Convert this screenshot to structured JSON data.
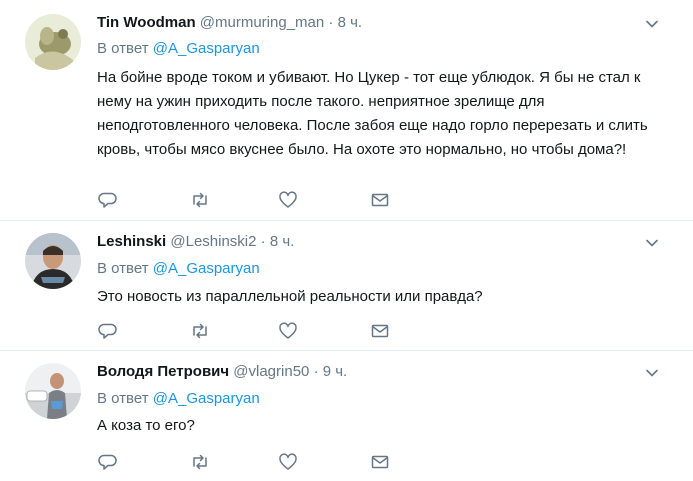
{
  "tweets": [
    {
      "name": "Tin Woodman",
      "handle": "@murmuring_man",
      "separator": "·",
      "time": "8 ч.",
      "reply_prefix": "В ответ",
      "reply_to": "@A_Gasparyan",
      "text": "На бойне вроде током и убивают. Но Цукер - тот еще ублюдок. Я бы не стал к нему на ужин приходить после такого. неприятное зрелище для неподготовленного человека. После забоя еще надо горло перерезать и слить кровь, чтобы мясо вкуснее было. На охоте это нормально, но чтобы дома?!"
    },
    {
      "name": "Leshinski",
      "handle": "@Leshinski2",
      "separator": "·",
      "time": "8 ч.",
      "reply_prefix": "В ответ",
      "reply_to": "@A_Gasparyan",
      "text": "Это новость из параллельной реальности или правда?"
    },
    {
      "name": "Володя Петрович",
      "handle": "@vlagrin50",
      "separator": "·",
      "time": "9 ч.",
      "reply_prefix": "В ответ",
      "reply_to": "@A_Gasparyan",
      "text": "А коза то его?"
    }
  ],
  "icons": {
    "reply": "reply-icon",
    "retweet": "retweet-icon",
    "like": "heart-icon",
    "dm": "envelope-icon",
    "menu": "chevron-down-icon"
  },
  "colors": {
    "link": "#1b95e0",
    "secondary_text": "#657786",
    "icon": "#657786",
    "divider": "#e6ecf0"
  }
}
